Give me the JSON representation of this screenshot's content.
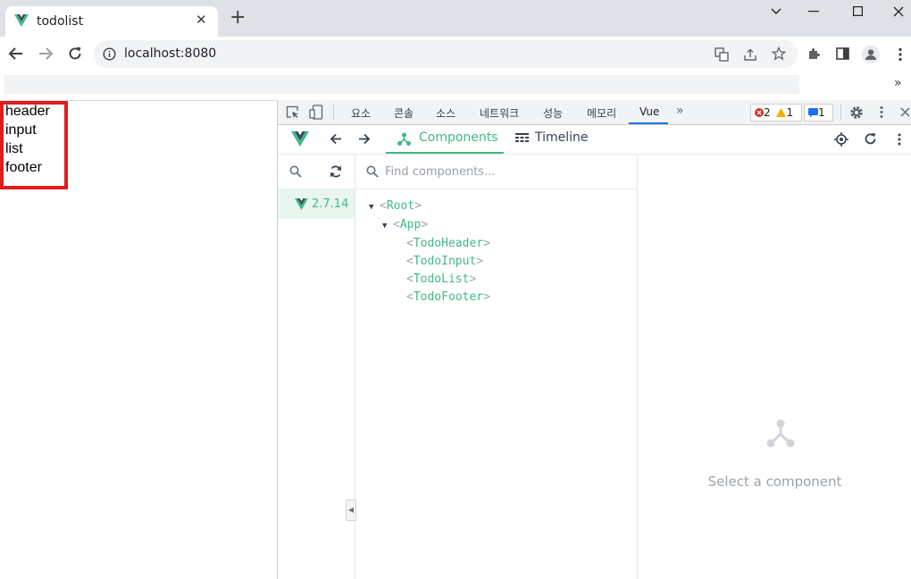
{
  "browser": {
    "tab_title": "todolist",
    "url": "localhost:8080",
    "new_tab_symbol": "+",
    "close_symbol": "✕",
    "overflow_symbol": "»"
  },
  "page": {
    "lines": [
      "header",
      "input",
      "list",
      "footer"
    ]
  },
  "devtools": {
    "tabs": [
      "요소",
      "콘솔",
      "소스",
      "네트워크",
      "성능",
      "메모리",
      "Vue"
    ],
    "active_tab": "Vue",
    "more_tabs_symbol": "»",
    "errors": "2",
    "warnings": "1",
    "messages": "1"
  },
  "vue": {
    "components_tab": "Components",
    "timeline_tab": "Timeline",
    "version": "2.7.14",
    "search_placeholder": "Find components...",
    "tree": [
      {
        "name": "Root",
        "depth": 0,
        "expanded": true
      },
      {
        "name": "App",
        "depth": 1,
        "expanded": true
      },
      {
        "name": "TodoHeader",
        "depth": 2
      },
      {
        "name": "TodoInput",
        "depth": 2
      },
      {
        "name": "TodoList",
        "depth": 2
      },
      {
        "name": "TodoFooter",
        "depth": 2
      }
    ],
    "empty_state": "Select a component"
  },
  "colors": {
    "vue_green": "#42b883",
    "highlight_border": "#e21b1b"
  }
}
